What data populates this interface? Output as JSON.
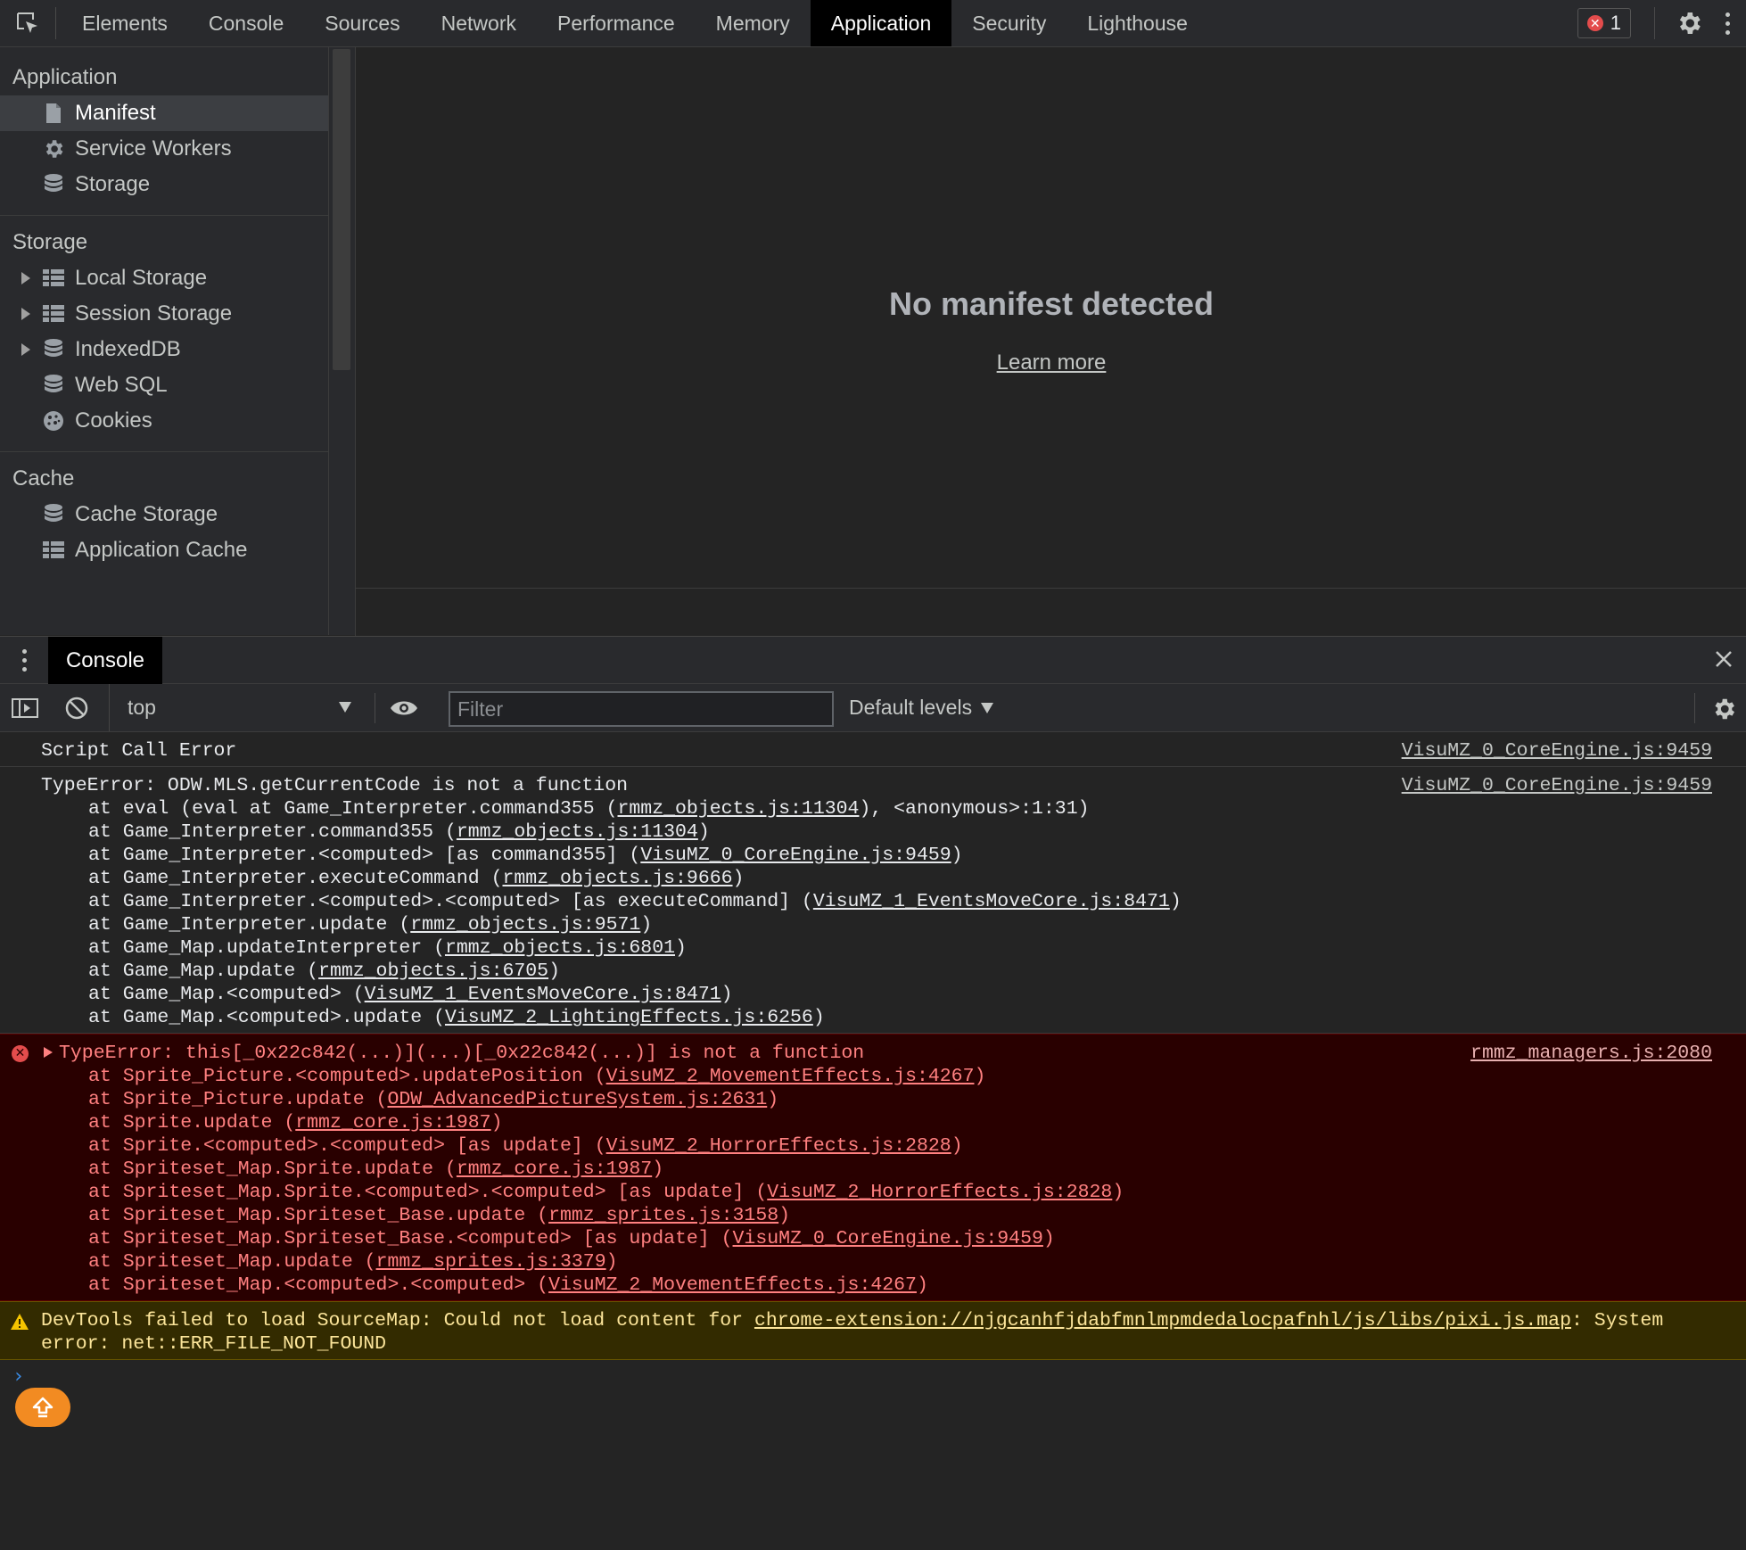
{
  "tabs": [
    "Elements",
    "Console",
    "Sources",
    "Network",
    "Performance",
    "Memory",
    "Application",
    "Security",
    "Lighthouse"
  ],
  "active_tab": "Application",
  "error_count": "1",
  "sidebar": {
    "sections": [
      {
        "title": "Application",
        "items": [
          {
            "label": "Manifest",
            "icon": "document-icon",
            "expandable": false,
            "selected": true
          },
          {
            "label": "Service Workers",
            "icon": "gear-icon",
            "expandable": false
          },
          {
            "label": "Storage",
            "icon": "database-icon",
            "expandable": false
          }
        ]
      },
      {
        "title": "Storage",
        "items": [
          {
            "label": "Local Storage",
            "icon": "grid-icon",
            "expandable": true
          },
          {
            "label": "Session Storage",
            "icon": "grid-icon",
            "expandable": true
          },
          {
            "label": "IndexedDB",
            "icon": "database-icon",
            "expandable": true
          },
          {
            "label": "Web SQL",
            "icon": "database-icon",
            "expandable": false
          },
          {
            "label": "Cookies",
            "icon": "cookie-icon",
            "expandable": false
          }
        ]
      },
      {
        "title": "Cache",
        "items": [
          {
            "label": "Cache Storage",
            "icon": "database-icon",
            "expandable": false
          },
          {
            "label": "Application Cache",
            "icon": "grid-icon",
            "expandable": false
          }
        ]
      }
    ]
  },
  "main": {
    "heading": "No manifest detected",
    "link": "Learn more"
  },
  "drawer": {
    "tab": "Console",
    "context": "top",
    "filter_placeholder": "Filter",
    "levels": "Default levels"
  },
  "messages": [
    {
      "type": "log",
      "source": "VisuMZ_0_CoreEngine.js:9459",
      "lines": [
        [
          {
            "t": "Script Call Error"
          }
        ]
      ]
    },
    {
      "type": "log",
      "source": "VisuMZ_0_CoreEngine.js:9459",
      "lines": [
        [
          {
            "t": "TypeError: ODW.MLS.getCurrentCode is not a function"
          }
        ],
        [
          {
            "t": "at eval (eval at Game_Interpreter.command355 ("
          },
          {
            "t": "rmmz_objects.js:11304",
            "u": true
          },
          {
            "t": "), <anonymous>:1:31)"
          }
        ],
        [
          {
            "t": "at Game_Interpreter.command355 ("
          },
          {
            "t": "rmmz_objects.js:11304",
            "u": true
          },
          {
            "t": ")"
          }
        ],
        [
          {
            "t": "at Game_Interpreter.<computed> [as command355] ("
          },
          {
            "t": "VisuMZ_0_CoreEngine.js:9459",
            "u": true
          },
          {
            "t": ")"
          }
        ],
        [
          {
            "t": "at Game_Interpreter.executeCommand ("
          },
          {
            "t": "rmmz_objects.js:9666",
            "u": true
          },
          {
            "t": ")"
          }
        ],
        [
          {
            "t": "at Game_Interpreter.<computed>.<computed> [as executeCommand] ("
          },
          {
            "t": "VisuMZ_1_EventsMoveCore.js:8471",
            "u": true
          },
          {
            "t": ")"
          }
        ],
        [
          {
            "t": "at Game_Interpreter.update ("
          },
          {
            "t": "rmmz_objects.js:9571",
            "u": true
          },
          {
            "t": ")"
          }
        ],
        [
          {
            "t": "at Game_Map.updateInterpreter ("
          },
          {
            "t": "rmmz_objects.js:6801",
            "u": true
          },
          {
            "t": ")"
          }
        ],
        [
          {
            "t": "at Game_Map.update ("
          },
          {
            "t": "rmmz_objects.js:6705",
            "u": true
          },
          {
            "t": ")"
          }
        ],
        [
          {
            "t": "at Game_Map.<computed> ("
          },
          {
            "t": "VisuMZ_1_EventsMoveCore.js:8471",
            "u": true
          },
          {
            "t": ")"
          }
        ],
        [
          {
            "t": "at Game_Map.<computed>.update ("
          },
          {
            "t": "VisuMZ_2_LightingEffects.js:6256",
            "u": true
          },
          {
            "t": ")"
          }
        ]
      ]
    },
    {
      "type": "error",
      "source": "rmmz_managers.js:2080",
      "lines": [
        [
          {
            "t": "TypeError: this[_0x22c842(...)](...)[_0x22c842(...)] is not a function"
          }
        ],
        [
          {
            "t": "at Sprite_Picture.<computed>.updatePosition ("
          },
          {
            "t": "VisuMZ_2_MovementEffects.js:4267",
            "u": true
          },
          {
            "t": ")"
          }
        ],
        [
          {
            "t": "at Sprite_Picture.update ("
          },
          {
            "t": "ODW_AdvancedPictureSystem.js:2631",
            "u": true
          },
          {
            "t": ")"
          }
        ],
        [
          {
            "t": "at Sprite.update ("
          },
          {
            "t": "rmmz_core.js:1987",
            "u": true
          },
          {
            "t": ")"
          }
        ],
        [
          {
            "t": "at Sprite.<computed>.<computed> [as update] ("
          },
          {
            "t": "VisuMZ_2_HorrorEffects.js:2828",
            "u": true
          },
          {
            "t": ")"
          }
        ],
        [
          {
            "t": "at Spriteset_Map.Sprite.update ("
          },
          {
            "t": "rmmz_core.js:1987",
            "u": true
          },
          {
            "t": ")"
          }
        ],
        [
          {
            "t": "at Spriteset_Map.Sprite.<computed>.<computed> [as update] ("
          },
          {
            "t": "VisuMZ_2_HorrorEffects.js:2828",
            "u": true
          },
          {
            "t": ")"
          }
        ],
        [
          {
            "t": "at Spriteset_Map.Spriteset_Base.update ("
          },
          {
            "t": "rmmz_sprites.js:3158",
            "u": true
          },
          {
            "t": ")"
          }
        ],
        [
          {
            "t": "at Spriteset_Map.Spriteset_Base.<computed> [as update] ("
          },
          {
            "t": "VisuMZ_0_CoreEngine.js:9459",
            "u": true
          },
          {
            "t": ")"
          }
        ],
        [
          {
            "t": "at Spriteset_Map.update ("
          },
          {
            "t": "rmmz_sprites.js:3379",
            "u": true
          },
          {
            "t": ")"
          }
        ],
        [
          {
            "t": "at Spriteset_Map.<computed>.<computed> ("
          },
          {
            "t": "VisuMZ_2_MovementEffects.js:4267",
            "u": true
          },
          {
            "t": ")"
          }
        ]
      ]
    },
    {
      "type": "warn",
      "source": "",
      "lines": [
        [
          {
            "t": "DevTools failed to load SourceMap: Could not load content for "
          },
          {
            "t": "chrome-extension://njgcanhfjdabfmnlmpmdedalocpafnhl/js/libs/pixi.js.map",
            "u": true
          },
          {
            "t": ": System"
          }
        ],
        [
          {
            "t": "error: net::ERR_FILE_NOT_FOUND"
          }
        ]
      ]
    }
  ],
  "prompt_symbol": "›",
  "colors": {
    "accent_orange": "#f28b22",
    "error_red": "#e34c4c",
    "prompt_blue": "#3b8eea"
  }
}
